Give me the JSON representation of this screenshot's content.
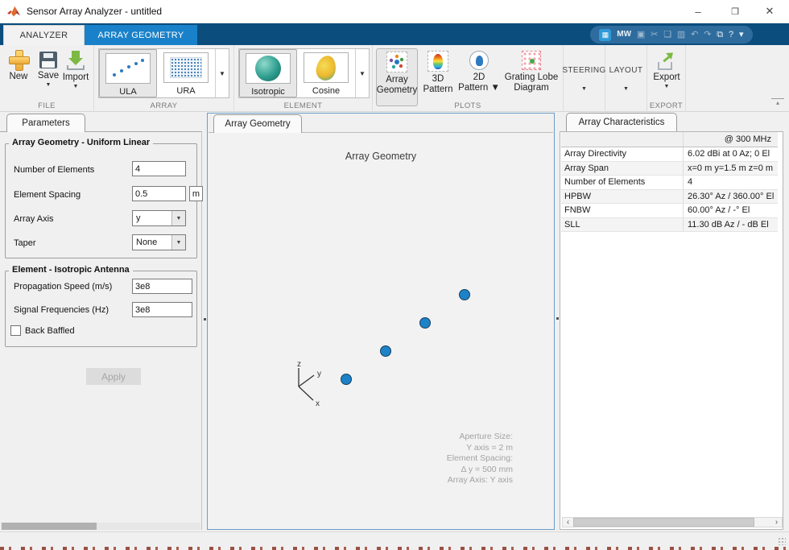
{
  "window": {
    "title": "Sensor Array Analyzer - untitled",
    "minimize_glyph": "–",
    "maximize_glyph": "❒",
    "close_glyph": "✕"
  },
  "ribbon": {
    "tab_analyzer": "ANALYZER",
    "tab_array_geometry": "ARRAY GEOMETRY",
    "collapse_glyph": "▴",
    "quick_access": {
      "shortcut_glyph": "▦",
      "mathworks_glyph": "MW",
      "save_glyph": "▣",
      "cut_glyph": "✂",
      "copy_glyph": "❑",
      "paste_glyph": "▥",
      "undo_glyph": "↶",
      "redo_glyph": "↷",
      "window_glyph": "⧉",
      "help_glyph": "?",
      "more_glyph": "▾"
    },
    "file": {
      "label": "FILE",
      "new": "New",
      "save": "Save",
      "import": "Import",
      "dropdown_glyph": "▼"
    },
    "array": {
      "label": "ARRAY",
      "ula": "ULA",
      "ura": "URA",
      "dropdown_glyph": "▼"
    },
    "element": {
      "label": "ELEMENT",
      "isotropic": "Isotropic",
      "cosine": "Cosine",
      "dropdown_glyph": "▼"
    },
    "plots": {
      "label": "PLOTS",
      "array_geometry": "Array\nGeometry",
      "pattern3d": "3D\nPattern",
      "pattern2d": "2D\nPattern ▼",
      "grating": "Grating Lobe\nDiagram"
    },
    "steering": {
      "label": "STEERING",
      "dropdown_glyph": "▼"
    },
    "layout": {
      "label": "LAYOUT",
      "dropdown_glyph": "▼"
    },
    "export": {
      "label": "EXPORT",
      "button": "Export",
      "dropdown_glyph": "▼"
    }
  },
  "parameters": {
    "tab": "Parameters",
    "geometry": {
      "title": "Array Geometry - Uniform Linear",
      "num_label": "Number of Elements",
      "num_value": "4",
      "spacing_label": "Element Spacing",
      "spacing_value": "0.5",
      "spacing_unit": "m",
      "axis_label": "Array Axis",
      "axis_value": "y",
      "taper_label": "Taper",
      "taper_value": "None",
      "select_glyph": "▼"
    },
    "element": {
      "title": "Element - Isotropic Antenna",
      "speed_label": "Propagation Speed (m/s)",
      "speed_value": "3e8",
      "freq_label": "Signal Frequencies (Hz)",
      "freq_value": "3e8",
      "baffled_label": "Back Baffled",
      "baffled_checked": false
    },
    "apply": "Apply"
  },
  "plot": {
    "tab": "Array Geometry",
    "title": "Array Geometry",
    "annotation": [
      "Aperture Size:",
      "Y axis = 2 m",
      "Element Spacing:",
      "Δ y = 500 mm",
      "Array Axis: Y axis"
    ],
    "axis": {
      "x": "x",
      "y": "y",
      "z": "z"
    },
    "dot_color": "#1d82c8"
  },
  "chart_data": {
    "type": "scatter",
    "title": "Array Geometry",
    "description": "4-element uniform linear array laid along the y axis, element spacing 0.5 m",
    "points_m": [
      {
        "x": 0,
        "y": -0.75,
        "z": 0
      },
      {
        "x": 0,
        "y": -0.25,
        "z": 0
      },
      {
        "x": 0,
        "y": 0.25,
        "z": 0
      },
      {
        "x": 0,
        "y": 0.75,
        "z": 0
      }
    ],
    "aperture_size_y_m": 2,
    "element_spacing_mm": 500,
    "array_axis": "Y axis",
    "marker_color": "#1d82c8"
  },
  "characteristics": {
    "tab": "Array Characteristics",
    "col_header": "@ 300 MHz",
    "rows": [
      {
        "name": "Array Directivity",
        "value": "6.02 dBi at 0 Az; 0 El"
      },
      {
        "name": "Array Span",
        "value": "x=0 m y=1.5 m z=0 m"
      },
      {
        "name": "Number of Elements",
        "value": "4"
      },
      {
        "name": "HPBW",
        "value": "26.30° Az / 360.00° El"
      },
      {
        "name": "FNBW",
        "value": "60.00° Az / -° El"
      },
      {
        "name": "SLL",
        "value": "11.30 dB Az / - dB El"
      }
    ],
    "scroll_left_glyph": "‹",
    "scroll_right_glyph": "›"
  }
}
